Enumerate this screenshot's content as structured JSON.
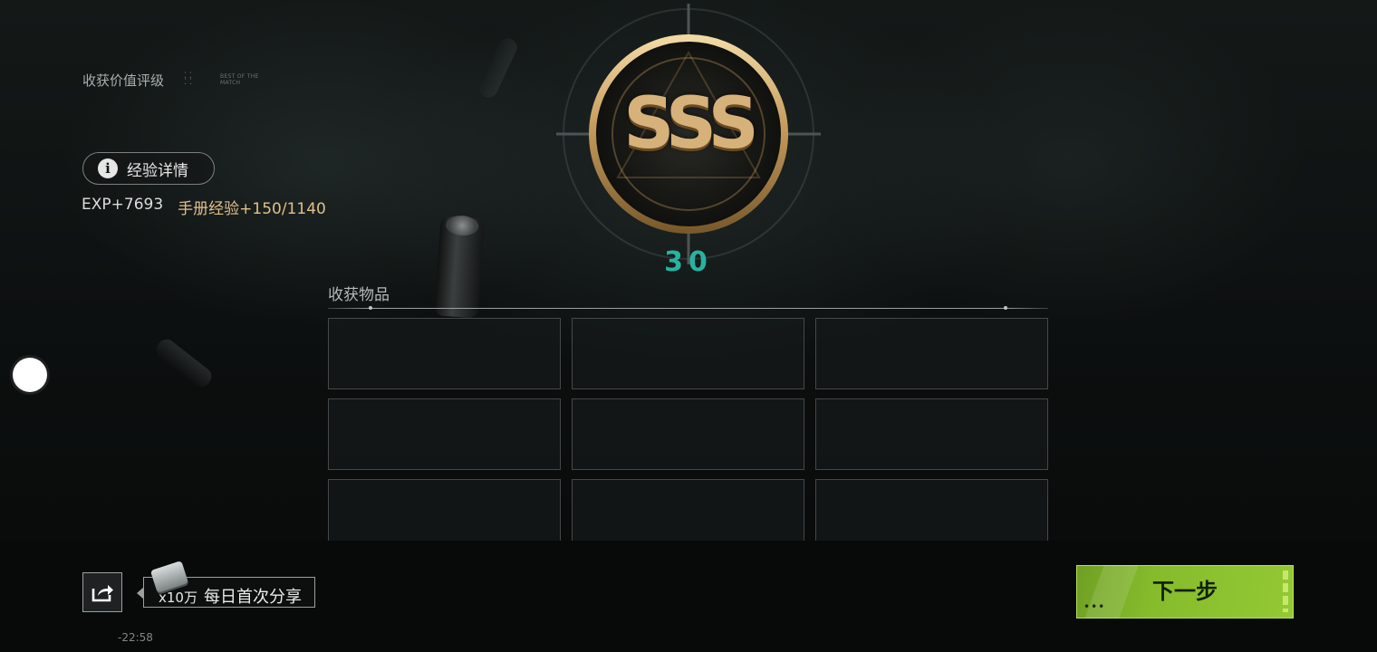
{
  "header": {
    "rating_label": "收获价值评级",
    "best_tag": "BEST OF THE MATCH"
  },
  "exp": {
    "detail_button": "经验详情",
    "value": "EXP+7693",
    "handbook": "手册经验+150/1140"
  },
  "rating": {
    "grade": "SSS",
    "score": "30"
  },
  "loot": {
    "title": "收获物品",
    "slot_count": 9
  },
  "share": {
    "reward_amount": "x10万",
    "reward_label": "每日首次分享"
  },
  "status": {
    "time": "-22:58"
  },
  "actions": {
    "next_label": "下一步"
  },
  "colors": {
    "accent_green": "#8cc332",
    "gold": "#c9a46a",
    "score_teal": "#28b2a0",
    "handbook_gold": "#e1c08a"
  }
}
